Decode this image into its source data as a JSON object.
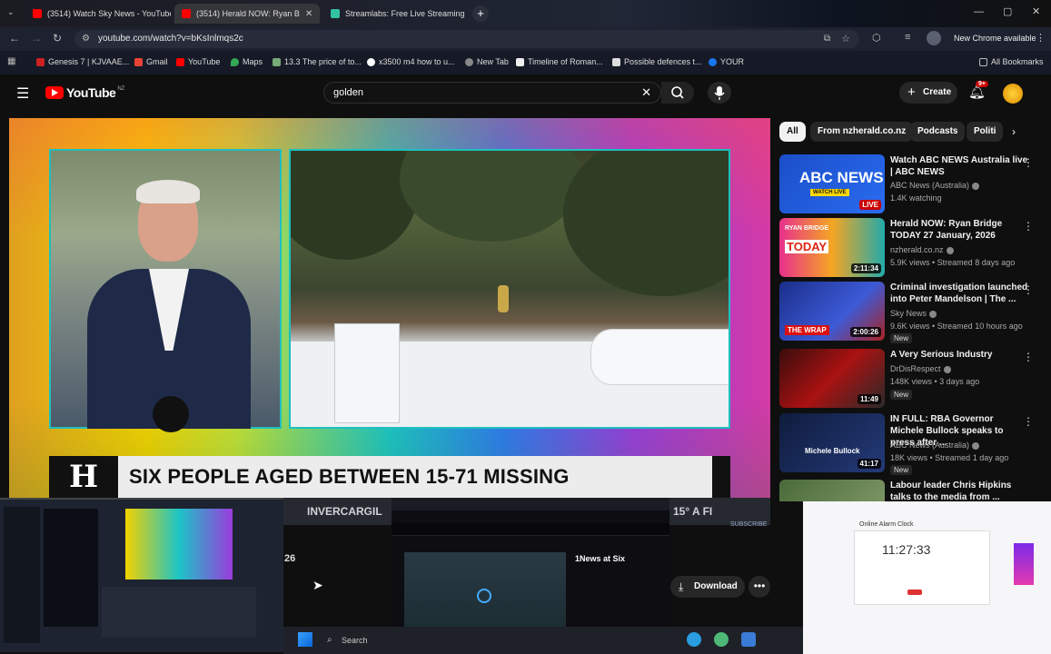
{
  "browser": {
    "tabs": [
      {
        "title": "(3514) Watch Sky News - YouTube",
        "color": "#ff0000"
      },
      {
        "title": "(3514) Herald NOW: Ryan B",
        "color": "#ff0000"
      },
      {
        "title": "Streamlabs: Free Live Streaming",
        "color": "#31c3a2"
      }
    ],
    "url": "youtube.com/watch?v=bKsInlmqs2c",
    "update_label": "New Chrome available",
    "bookmarks": [
      "Genesis 7 | KJVAAE...",
      "Gmail",
      "YouTube",
      "Maps",
      "13.3 The price of to...",
      "x3500 m4 how to u...",
      "New Tab",
      "Timeline of Roman...",
      "Possible defences t...",
      "YOUR"
    ],
    "all_bookmarks": "All Bookmarks"
  },
  "youtube": {
    "logo_text": "YouTube",
    "region": "NZ",
    "search_value": "golden",
    "create_label": "Create",
    "notif_badge": "9+"
  },
  "player": {
    "headline": "SIX PEOPLE AGED BETWEEN 15-71 MISSING",
    "logo_letter": "H",
    "ticker_left": "INVERCARGIL",
    "ticker_right": "15° A FI",
    "subscribe": "SUBSCRIBE",
    "partial_number": "26"
  },
  "actions": {
    "download_label": "Download",
    "more": "•••"
  },
  "chips": [
    "All",
    "From nzherald.co.nz",
    "Podcasts",
    "Politi"
  ],
  "recommendations": [
    {
      "title": "Watch ABC NEWS Australia live | ABC NEWS",
      "channel": "ABC News (Australia)",
      "meta": "1.4K watching",
      "badge": "LIVE",
      "new": ""
    },
    {
      "title": "Herald NOW: Ryan Bridge TODAY 27 January, 2026",
      "channel": "nzherald.co.nz",
      "meta": "5.9K views • Streamed 8 days ago",
      "badge": "2:11:34",
      "new": ""
    },
    {
      "title": "Criminal investigation launched into Peter Mandelson | The ...",
      "channel": "Sky News",
      "meta": "9.6K views • Streamed 10 hours ago",
      "badge": "2:00:26",
      "new": "New"
    },
    {
      "title": "A Very Serious Industry",
      "channel": "DrDisRespect",
      "meta": "148K views • 3 days ago",
      "badge": "11:49",
      "new": "New"
    },
    {
      "title": "IN FULL: RBA Governor Michele Bullock speaks to press after ...",
      "channel": "ABC News (Australia)",
      "meta": "18K views • Streamed 1 day ago",
      "badge": "41:17",
      "new": "New"
    },
    {
      "title": "Labour leader Chris Hipkins talks to the media from ...",
      "channel": "",
      "meta": "",
      "badge": "",
      "new": ""
    }
  ],
  "thumb_labels": {
    "abc_news": "ABC NEWS",
    "watch_live": "WATCH LIVE",
    "ryan_bridge": "RYAN BRIDGE",
    "today": "TODAY",
    "the_wrap": "THE WRAP",
    "michele": "Michele Bullock"
  },
  "overlay": {
    "clock": "11:27:33",
    "clock_title": "Online Alarm Clock",
    "news_title": "1News at Six",
    "taskbar_search": "Search"
  }
}
